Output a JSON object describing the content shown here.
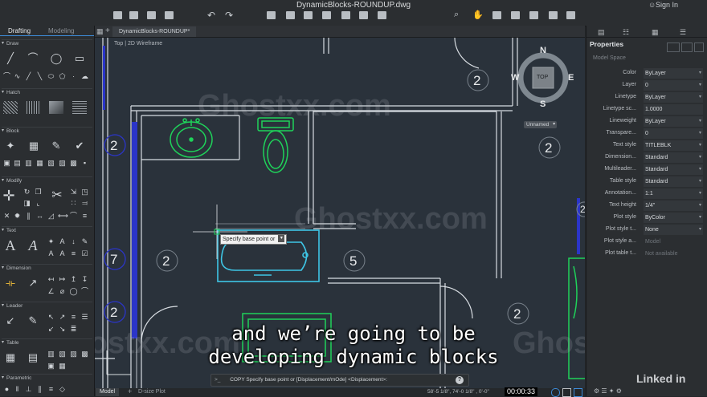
{
  "window": {
    "title": "DynamicBlocks-ROUNDUP.dwg",
    "sign_in": "Sign In"
  },
  "palette": {
    "tabs": [
      "Drafting",
      "Modeling"
    ],
    "sections": [
      "Draw",
      "Hatch",
      "Block",
      "Modify",
      "Text",
      "Dimension",
      "Leader",
      "Table",
      "Parametric"
    ]
  },
  "document": {
    "tab": "DynamicBlocks-ROUNDUP*",
    "plus": "+",
    "view_label": "Top | 2D Wireframe"
  },
  "viewcube": {
    "north": "N",
    "south": "S",
    "east": "E",
    "west": "W",
    "face": "TOP",
    "unnamed": "Unnamed"
  },
  "drawing": {
    "tags": [
      "2",
      "2",
      "7",
      "2",
      "2",
      "5",
      "2",
      "2",
      "2"
    ],
    "tooltip": "Specify base point or"
  },
  "command": {
    "prompt": ">_",
    "text": "COPY Specify base point or [Displacement/mOde] <Displacement>:",
    "help": "?"
  },
  "status": {
    "model_tab": "Model",
    "layout_tab": "D-size Plot",
    "coords": "58'-5 1/8\", 74'-0 1/8\" , 0'-0\"",
    "time": "00:00:33",
    "brand": "Linked in"
  },
  "properties": {
    "title": "Properties",
    "space": "Model Space",
    "rows": [
      {
        "label": "Color",
        "value": "ByLayer"
      },
      {
        "label": "Layer",
        "value": "0"
      },
      {
        "label": "Linetype",
        "value": "ByLayer"
      },
      {
        "label": "Linetype sc...",
        "value": "1.0000"
      },
      {
        "label": "Lineweight",
        "value": "ByLayer"
      },
      {
        "label": "Transpare...",
        "value": "0"
      },
      {
        "label": "Text style",
        "value": "TITLEBLK"
      },
      {
        "label": "Dimension...",
        "value": "Standard"
      },
      {
        "label": "Multileader...",
        "value": "Standard"
      },
      {
        "label": "Table style",
        "value": "Standard"
      },
      {
        "label": "Annotation...",
        "value": "1:1"
      },
      {
        "label": "Text height",
        "value": "1/4\""
      },
      {
        "label": "Plot style",
        "value": "ByColor"
      },
      {
        "label": "Plot style t...",
        "value": "None"
      },
      {
        "label": "Plot style a...",
        "value": "Model"
      },
      {
        "label": "Plot table t...",
        "value": "Not available"
      }
    ]
  },
  "caption": {
    "line1": "and we’re going to be",
    "line2": "developing dynamic blocks"
  },
  "watermark": {
    "text": "Ghostxx.com"
  },
  "colors": {
    "accent": "#3d8bd8",
    "fixture": "#1fd25a",
    "tub": "#3ec6e6",
    "tag": "#2b35c9"
  }
}
